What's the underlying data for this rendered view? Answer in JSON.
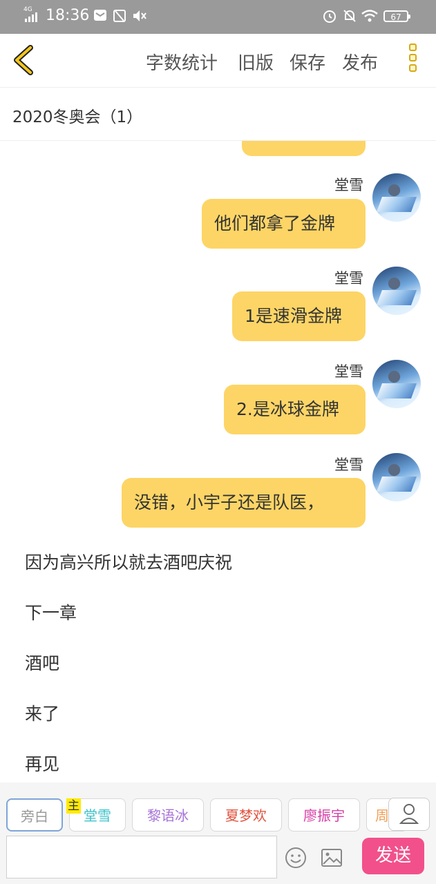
{
  "status_bar": {
    "network": "4G",
    "time": "18:36",
    "battery": "67"
  },
  "toolbar": {
    "word_count": "字数统计",
    "old_version": "旧版",
    "save": "保存",
    "publish": "发布"
  },
  "chapter_title": "2020冬奥会（1）",
  "messages": [
    {
      "speaker": "堂雪",
      "text": "他们都拿了金牌"
    },
    {
      "speaker": "堂雪",
      "text": "1是速滑金牌"
    },
    {
      "speaker": "堂雪",
      "text": "2.是冰球金牌"
    },
    {
      "speaker": "堂雪",
      "text": "没错，小宇子还是队医，"
    }
  ],
  "narration": [
    "因为高兴所以就去酒吧庆祝",
    "下一章",
    "酒吧",
    "来了",
    "再见"
  ],
  "roles": [
    {
      "label": "旁白",
      "color": "#999999"
    },
    {
      "label": "堂雪",
      "color": "#3cc2c9",
      "tag": "主"
    },
    {
      "label": "黎语冰",
      "color": "#a874d8"
    },
    {
      "label": "夏梦欢",
      "color": "#e0533f"
    },
    {
      "label": "廖振宇",
      "color": "#d63fa6"
    },
    {
      "label": "周",
      "color": "#f0a05a"
    }
  ],
  "input": {
    "value": ""
  },
  "send_label": "发送"
}
